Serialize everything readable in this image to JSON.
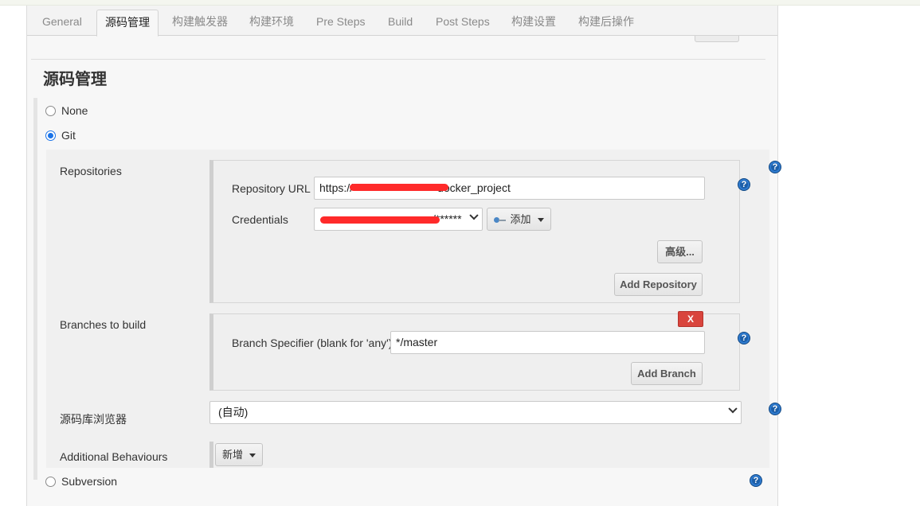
{
  "tabs": [
    {
      "label": "General",
      "active": false
    },
    {
      "label": "源码管理",
      "active": true
    },
    {
      "label": "构建触发器",
      "active": false
    },
    {
      "label": "构建环境",
      "active": false
    },
    {
      "label": "Pre Steps",
      "active": false
    },
    {
      "label": "Build",
      "active": false
    },
    {
      "label": "Post Steps",
      "active": false
    },
    {
      "label": "构建设置",
      "active": false
    },
    {
      "label": "构建后操作",
      "active": false
    }
  ],
  "section_title": "源码管理",
  "scm": {
    "none_label": "None",
    "git_label": "Git",
    "subversion_label": "Subversion",
    "selected": "Git"
  },
  "repositories": {
    "label": "Repositories",
    "url_label": "Repository URL",
    "url_value": "https://",
    "url_value_tail": "docker_project",
    "credentials_label": "Credentials",
    "credentials_value": "/******",
    "add_label": "添加",
    "advanced_label": "高级...",
    "add_repository_label": "Add Repository"
  },
  "branches": {
    "label": "Branches to build",
    "delete_label": "X",
    "specifier_label": "Branch Specifier (blank for 'any')",
    "specifier_value": "*/master",
    "add_branch_label": "Add Branch"
  },
  "browser": {
    "label": "源码库浏览器",
    "value": "(自动)"
  },
  "behaviours": {
    "label": "Additional Behaviours",
    "add_label": "新增"
  },
  "help_icon_glyph": "?",
  "colors": {
    "accent": "#1a73e8",
    "help": "#1d5fa8",
    "danger": "#d9453d",
    "redaction": "#ff2a2a"
  }
}
